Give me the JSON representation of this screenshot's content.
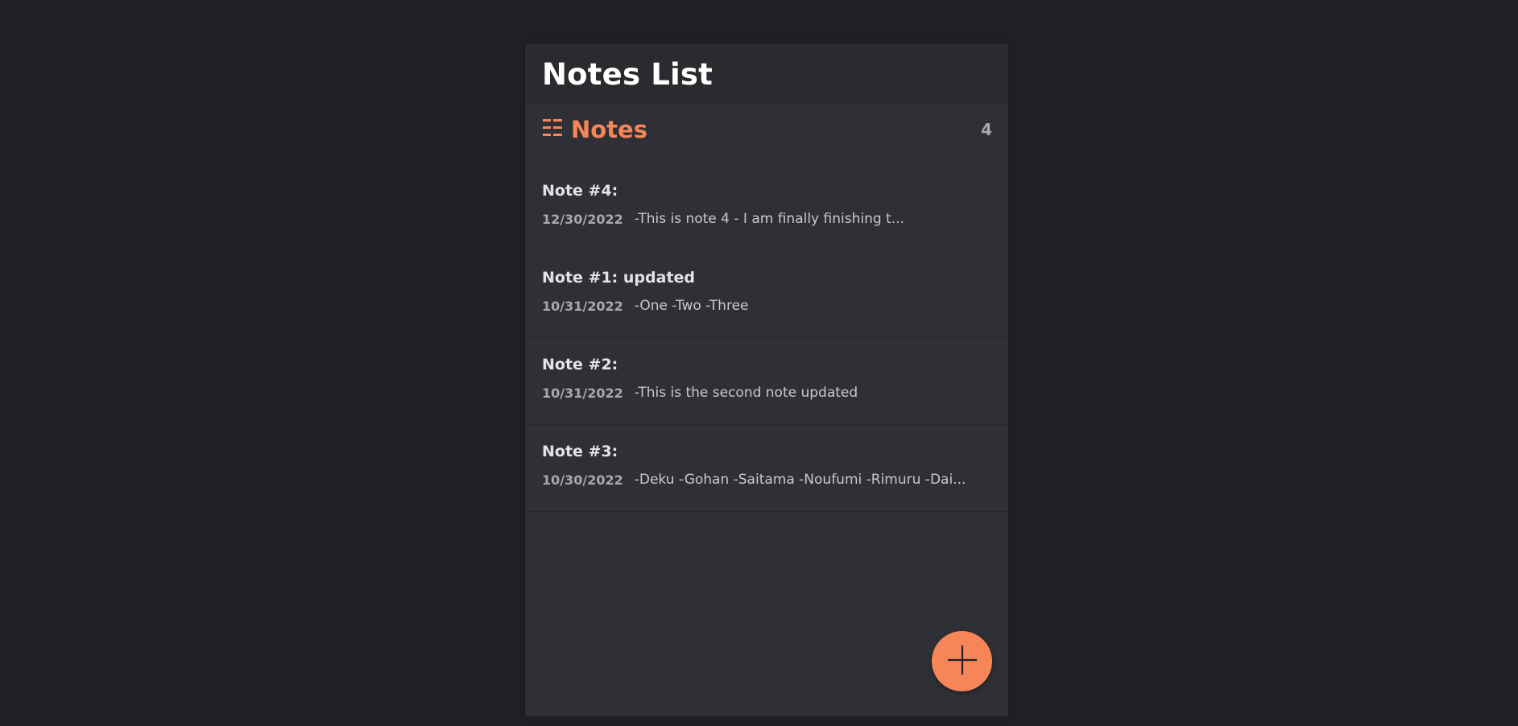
{
  "header": {
    "title": "Notes List"
  },
  "notes_section": {
    "heading": "Notes",
    "count": "4",
    "icon": "list-icon",
    "accent_color": "#f68657"
  },
  "notes": [
    {
      "title": "Note #4:",
      "date": "12/30/2022",
      "preview": "-This is note 4 - I am finally finishing t..."
    },
    {
      "title": "Note #1: updated",
      "date": "10/31/2022",
      "preview": "-One -Two -Three"
    },
    {
      "title": "Note #2:",
      "date": "10/31/2022",
      "preview": "-This is the second note updated"
    },
    {
      "title": "Note #3:",
      "date": "10/30/2022",
      "preview": "-Deku -Gohan -Saitama -Noufumi -Rimuru -Dai..."
    }
  ],
  "fab": {
    "icon": "plus-icon"
  }
}
